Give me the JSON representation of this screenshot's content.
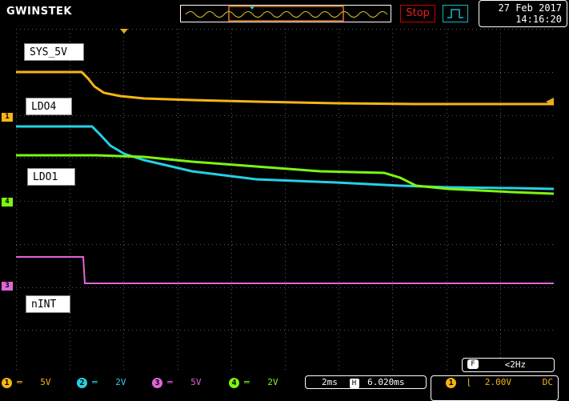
{
  "header": {
    "brand": "GWINSTEK",
    "run_state": "Stop",
    "trigger_icon": "square-wave-icon",
    "date": "27 Feb 2017",
    "time": "14:16:20"
  },
  "traces": [
    {
      "name": "SYS_5V",
      "color": "#f5b514"
    },
    {
      "name": "LDO4",
      "color": "#25d0e6"
    },
    {
      "name": "LDO1",
      "color": "#7df514"
    },
    {
      "name": "nINT",
      "color": "#e066d8"
    }
  ],
  "channel_markers": [
    "1",
    "4",
    "3"
  ],
  "footer": {
    "channels": [
      {
        "num": "1",
        "coupling": "═",
        "scale": "5V",
        "color": "#f5b514"
      },
      {
        "num": "2",
        "coupling": "═",
        "scale": "2V",
        "color": "#25d0e6"
      },
      {
        "num": "3",
        "coupling": "═",
        "scale": "5V",
        "color": "#e066d8"
      },
      {
        "num": "4",
        "coupling": "═",
        "scale": "2V",
        "color": "#7df514"
      }
    ],
    "timebase": "2ms",
    "h_label": "H",
    "h_position": "6.020ms",
    "freq_label": "F",
    "freq_value": "<2Hz",
    "trigger_source": "1",
    "trigger_level": "2.00V",
    "trigger_coupling": "DC"
  }
}
